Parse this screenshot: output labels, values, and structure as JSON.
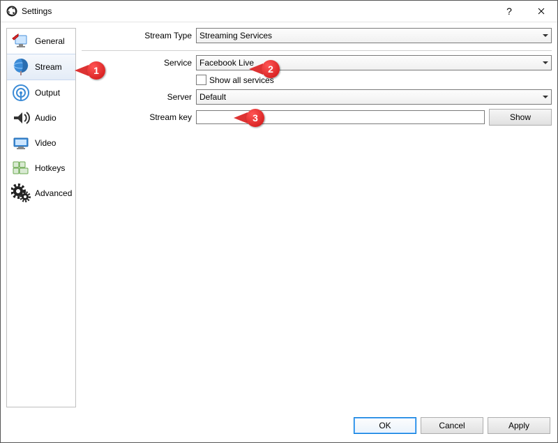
{
  "window": {
    "title": "Settings"
  },
  "sidebar": {
    "items": [
      {
        "label": "General",
        "icon": "general"
      },
      {
        "label": "Stream",
        "icon": "stream",
        "selected": true
      },
      {
        "label": "Output",
        "icon": "output"
      },
      {
        "label": "Audio",
        "icon": "audio"
      },
      {
        "label": "Video",
        "icon": "video"
      },
      {
        "label": "Hotkeys",
        "icon": "hotkeys"
      },
      {
        "label": "Advanced",
        "icon": "advanced"
      }
    ]
  },
  "form": {
    "stream_type_label": "Stream Type",
    "stream_type_value": "Streaming Services",
    "service_label": "Service",
    "service_value": "Facebook Live",
    "show_all_label": "Show all services",
    "server_label": "Server",
    "server_value": "Default",
    "stream_key_label": "Stream key",
    "stream_key_value": "",
    "show_button": "Show"
  },
  "footer": {
    "ok": "OK",
    "cancel": "Cancel",
    "apply": "Apply"
  },
  "callouts": {
    "c1": "1",
    "c2": "2",
    "c3": "3"
  }
}
